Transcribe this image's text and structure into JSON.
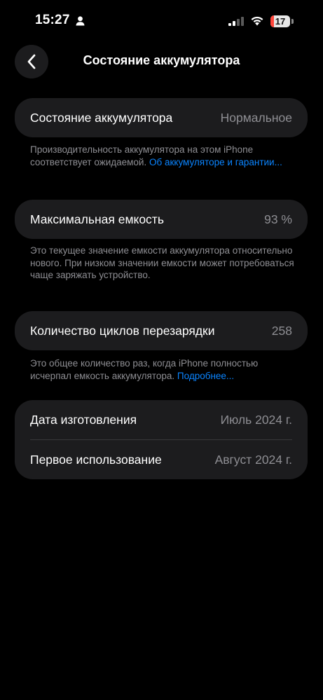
{
  "status_bar": {
    "time": "15:27",
    "battery_percent": "17",
    "battery_fraction": 0.17,
    "icons": [
      "person-icon",
      "signal-icon",
      "wifi-icon",
      "battery-icon"
    ]
  },
  "nav": {
    "back_icon": "chevron-left-icon",
    "title": "Состояние аккумулятора"
  },
  "sections": {
    "health": {
      "label": "Состояние аккумулятора",
      "value": "Нормальное",
      "footnote_text": "Производительность аккумулятора на этом iPhone соответствует ожидаемой. ",
      "footnote_link": "Об аккумуляторе и гарантии..."
    },
    "capacity": {
      "label": "Максимальная емкость",
      "value": "93 %",
      "footnote_text": "Это текущее значение емкости аккумулятора относительно нового. При низком значении емкости может потребоваться чаще заряжать устройство."
    },
    "cycles": {
      "label": "Количество циклов перезарядки",
      "value": "258",
      "footnote_text": "Это общее количество раз, когда iPhone полностью исчерпал емкость аккумулятора. ",
      "footnote_link": "Подробнее..."
    },
    "dates": {
      "manufacture_label": "Дата изготовления",
      "manufacture_value": "Июль 2024 г.",
      "first_use_label": "Первое использование",
      "first_use_value": "Август 2024 г."
    }
  },
  "colors": {
    "background": "#000000",
    "card": "#1c1c1e",
    "secondary_text": "#8e8e93",
    "link": "#0a84ff",
    "battery_low": "#ff453a"
  }
}
